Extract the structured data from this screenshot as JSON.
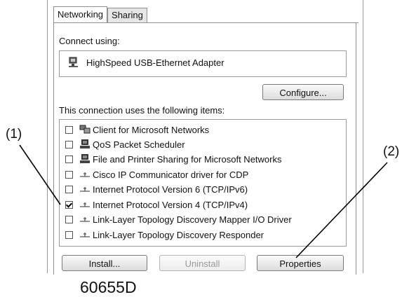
{
  "tabs": [
    {
      "label": "Networking",
      "active": true
    },
    {
      "label": "Sharing",
      "active": false
    }
  ],
  "connect_using_label": "Connect using:",
  "adapter": {
    "name": "HighSpeed USB-Ethernet Adapter",
    "icon": "network-adapter-icon"
  },
  "configure_button": "Configure...",
  "items_label": "This connection uses the following items:",
  "items": [
    {
      "label": "Client for Microsoft Networks",
      "checked": false,
      "icon": "network-client-icon"
    },
    {
      "label": "QoS Packet Scheduler",
      "checked": false,
      "icon": "computer-icon"
    },
    {
      "label": "File and Printer Sharing for Microsoft Networks",
      "checked": false,
      "icon": "computer-icon"
    },
    {
      "label": "Cisco IP Communicator driver for CDP",
      "checked": false,
      "icon": "protocol-icon"
    },
    {
      "label": "Internet Protocol Version 6 (TCP/IPv6)",
      "checked": false,
      "icon": "protocol-icon"
    },
    {
      "label": "Internet Protocol Version 4 (TCP/IPv4)",
      "checked": true,
      "icon": "protocol-icon"
    },
    {
      "label": "Link-Layer Topology Discovery Mapper I/O Driver",
      "checked": false,
      "icon": "protocol-icon"
    },
    {
      "label": "Link-Layer Topology Discovery Responder",
      "checked": false,
      "icon": "protocol-icon"
    }
  ],
  "buttons": {
    "install": "Install...",
    "uninstall": "Uninstall",
    "properties": "Properties"
  },
  "callouts": {
    "one": "(1)",
    "two": "(2)"
  },
  "figure_code": "60655D"
}
